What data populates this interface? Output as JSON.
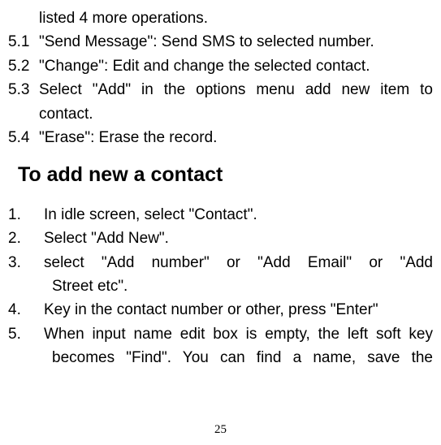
{
  "top": {
    "line0": "listed 4 more operations.",
    "item1_num": "5.1",
    "item1_text": "\"Send Message\": Send SMS to selected number.",
    "item2_num": "5.2",
    "item2_text": "\"Change\": Edit and change the selected contact.",
    "item3_num": "5.3",
    "item3_text_a": "Select \"Add\" in the options menu add new item to",
    "item3_text_b": "contact.",
    "item4_num": "5.4",
    "item4_text": "\"Erase\": Erase the record."
  },
  "heading": "To add new a contact",
  "list": {
    "item1_num": "1.",
    "item1_text": "In idle screen, select \"Contact\".",
    "item2_num": "2.",
    "item2_text": "Select \"Add New\".",
    "item3_num": "3.",
    "item3_text_a": "select  \"Add number\" or \"Add Email\"  or  \"Add",
    "item3_text_b": "Street etc\".",
    "item4_num": "4.",
    "item4_text": "Key in the contact number or other, press \"Enter\"",
    "item5_num": "5.",
    "item5_text_a": "When input name edit box is empty, the left soft key",
    "item5_text_b": "becomes \"Find\". You can find a name, save the"
  },
  "page_number": "25"
}
